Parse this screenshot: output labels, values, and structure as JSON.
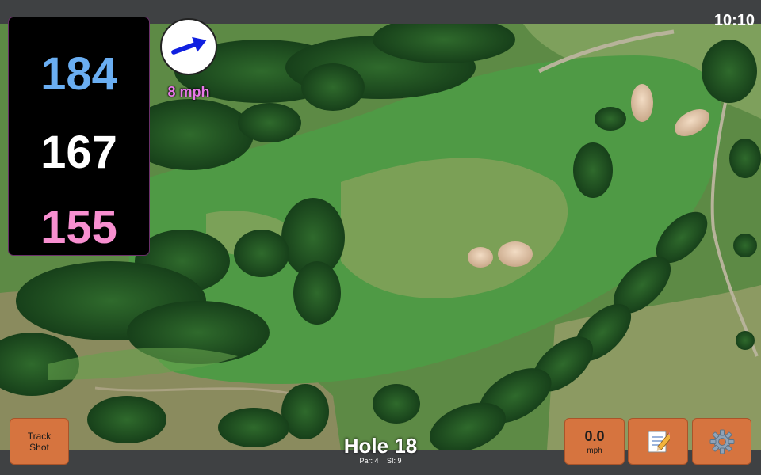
{
  "status_bar": {
    "time": "10:10"
  },
  "distances": {
    "back": "184",
    "middle": "167",
    "front": "155"
  },
  "wind": {
    "speed": "8 mph",
    "direction_deg": 70
  },
  "hole": {
    "title": "Hole 18",
    "par": "Par: 4",
    "si": "SI: 9"
  },
  "buttons": {
    "track_shot_line1": "Track",
    "track_shot_line2": "Shot",
    "speed_value": "0.0",
    "speed_unit": "mph"
  },
  "icons": {
    "wind_arrow": "arrow-icon",
    "notes": "memo-icon",
    "settings": "gear-icon"
  },
  "colors": {
    "back_distance": "#6aaef2",
    "middle_distance": "#ffffff",
    "front_distance": "#f78fd0",
    "wind_text": "#e878e8",
    "wind_arrow": "#1020e0",
    "button": "#d6743f"
  }
}
